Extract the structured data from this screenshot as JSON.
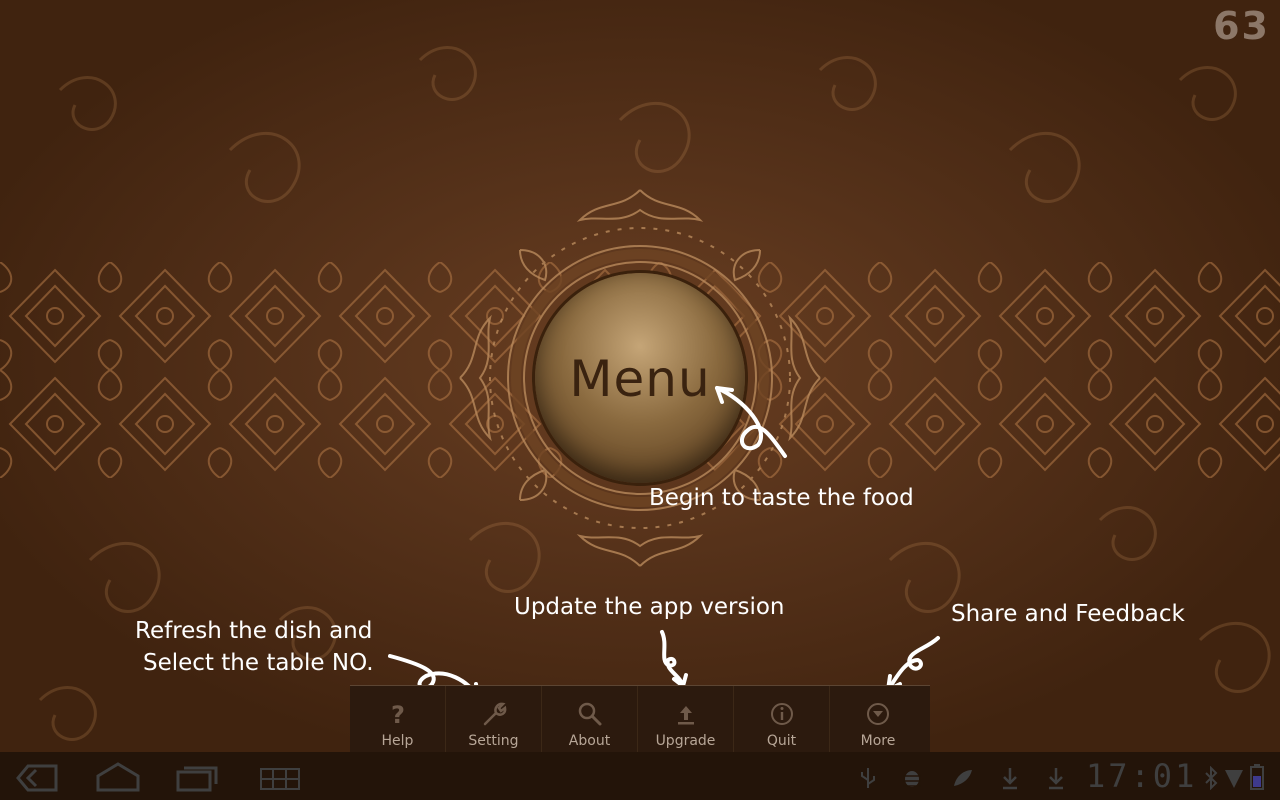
{
  "counter": "63",
  "menu_button": {
    "label": "Menu"
  },
  "annotations": {
    "menu": "Begin to taste the food",
    "refresh_line1": "Refresh the dish and",
    "refresh_line2": "Select the table NO.",
    "upgrade": "Update the app version",
    "more": "Share and Feedback"
  },
  "bottom_menu": {
    "items": [
      {
        "label": "Help",
        "icon": "question-icon"
      },
      {
        "label": "Setting",
        "icon": "wrench-icon"
      },
      {
        "label": "About",
        "icon": "magnifier-icon"
      },
      {
        "label": "Upgrade",
        "icon": "upload-icon"
      },
      {
        "label": "Quit",
        "icon": "info-icon"
      },
      {
        "label": "More",
        "icon": "circle-down-icon"
      }
    ]
  },
  "system_bar": {
    "clock": "17:01",
    "nav_icons": [
      "back-icon",
      "home-icon",
      "recent-apps-icon",
      "grid-icon"
    ],
    "status_icons": [
      "usb-icon",
      "android-debug-icon",
      "leaf-icon",
      "download-icon",
      "download-icon",
      "bluetooth-icon",
      "wifi-icon",
      "battery-icon"
    ]
  },
  "colors": {
    "background": "#56321a",
    "annotation_text": "#ffffff",
    "panel": "#2c1a0e",
    "panel_label": "#b7a697",
    "system_bar": "#231409"
  }
}
